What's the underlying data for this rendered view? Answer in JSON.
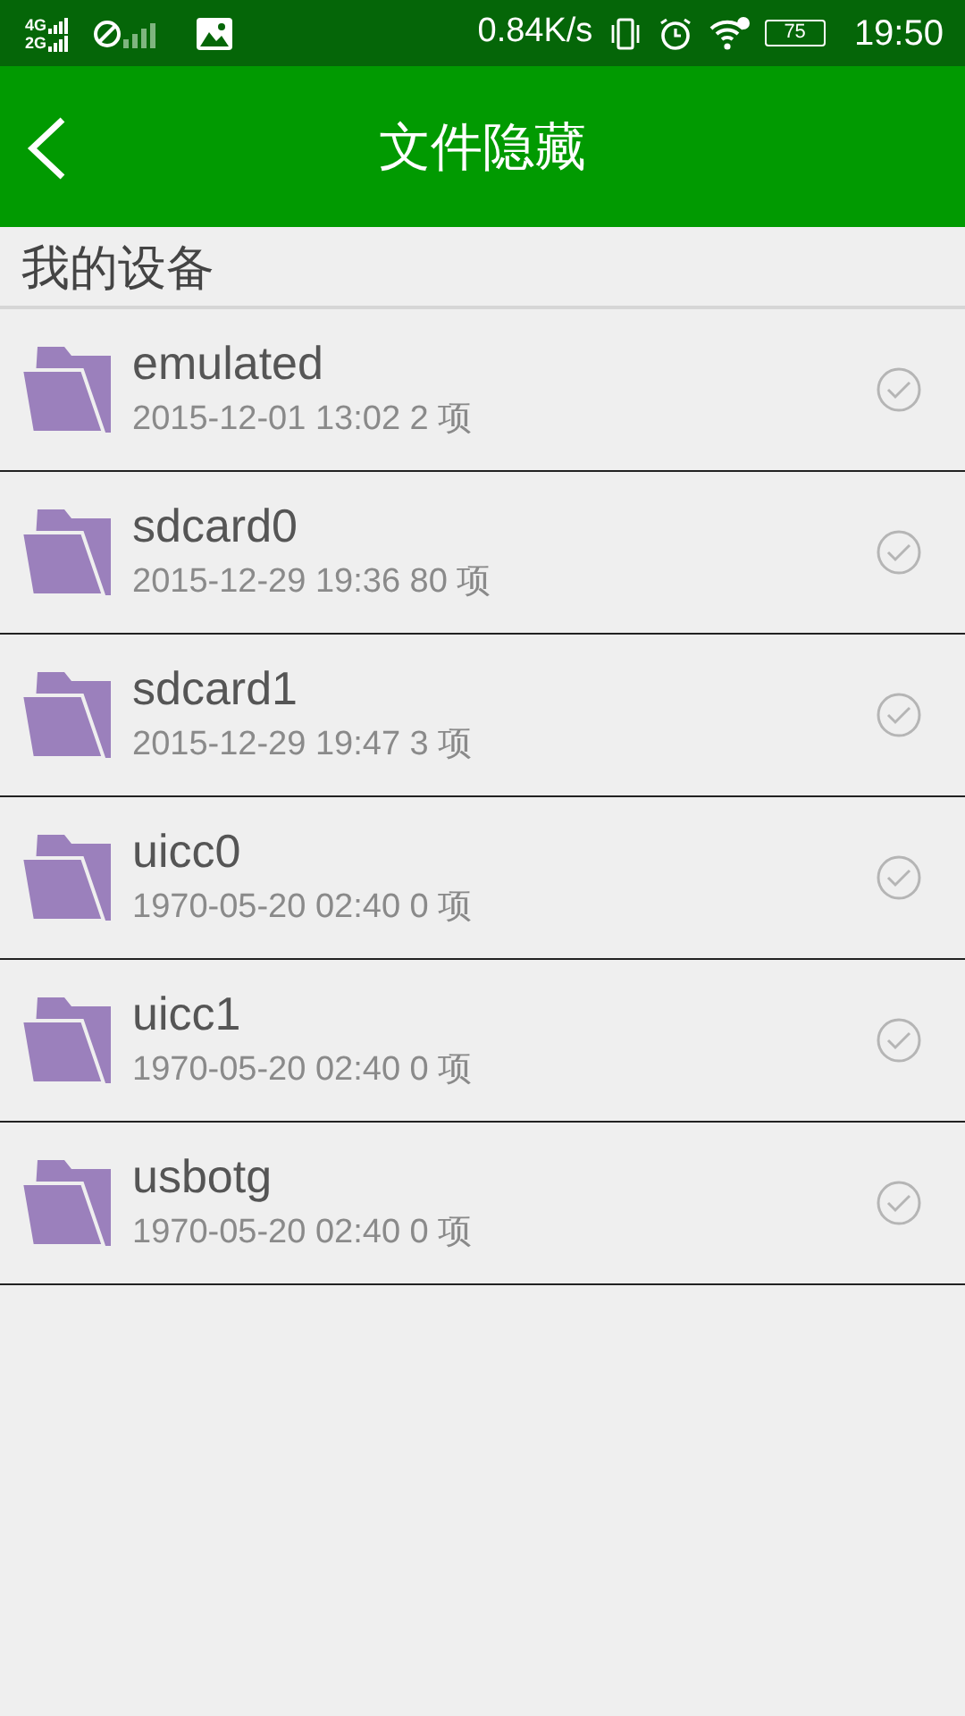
{
  "status_bar": {
    "network_labels": [
      "4G",
      "2G"
    ],
    "speed": "0.84K/s",
    "battery": "75",
    "time": "19:50"
  },
  "header": {
    "title": "文件隐藏"
  },
  "section": {
    "title": "我的设备"
  },
  "folders": [
    {
      "name": "emulated",
      "meta": "2015-12-01 13:02 2 项",
      "checked": false
    },
    {
      "name": "sdcard0",
      "meta": "2015-12-29 19:36 80 项",
      "checked": false
    },
    {
      "name": "sdcard1",
      "meta": "2015-12-29 19:47 3 项",
      "checked": false
    },
    {
      "name": "uicc0",
      "meta": "1970-05-20 02:40 0 项",
      "checked": false
    },
    {
      "name": "uicc1",
      "meta": "1970-05-20 02:40 0 项",
      "checked": false
    },
    {
      "name": "usbotg",
      "meta": "1970-05-20 02:40 0 项",
      "checked": false
    }
  ]
}
